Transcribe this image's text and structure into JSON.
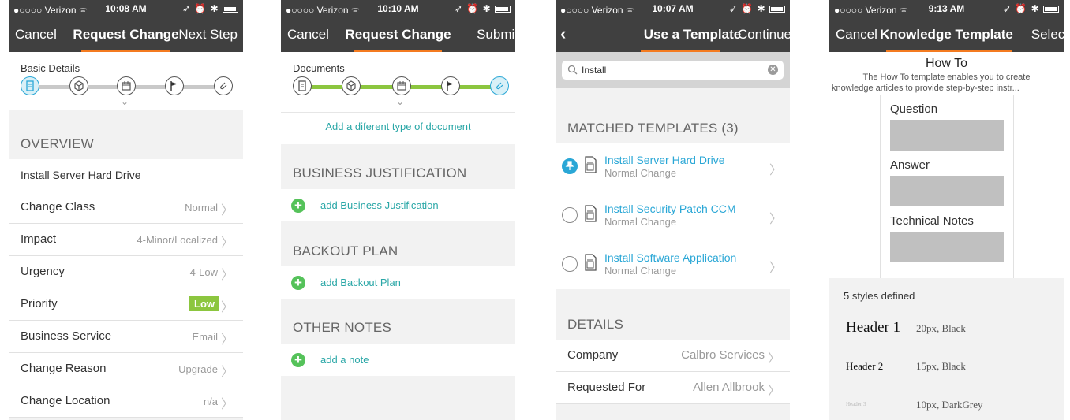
{
  "status": {
    "carrier": "●○○○○ Verizon ᯤ",
    "right_icons": "➶ ⏰ ✱"
  },
  "screen1": {
    "time": "10:08 AM",
    "nav_left": "Cancel",
    "nav_title": "Request Change",
    "nav_right": "Next Step",
    "step_label": "Basic Details",
    "section_overview": "OVERVIEW",
    "summary": "Install Server Hard Drive",
    "rows": [
      {
        "label": "Change Class",
        "value": "Normal"
      },
      {
        "label": "Impact",
        "value": "4-Minor/Localized"
      },
      {
        "label": "Urgency",
        "value": "4-Low"
      },
      {
        "label": "Priority",
        "value": "Low"
      },
      {
        "label": "Business Service",
        "value": "Email"
      },
      {
        "label": "Change Reason",
        "value": "Upgrade"
      },
      {
        "label": "Change Location",
        "value": "n/a"
      }
    ],
    "priority_badge_color": "#8cc63f"
  },
  "screen2": {
    "time": "10:10 AM",
    "nav_left": "Cancel",
    "nav_title": "Request Change",
    "nav_right": "Submit",
    "step_label": "Documents",
    "add_doc_type": "Add a diferent type of document",
    "section_business": "BUSINESS JUSTIFICATION",
    "add_business": "add Business Justification",
    "section_backout": "BACKOUT PLAN",
    "add_backout": "add Backout Plan",
    "section_notes": "OTHER NOTES",
    "add_note": "add a note",
    "progress_color": "#8cc63f"
  },
  "screen3": {
    "time": "10:07 AM",
    "nav_title": "Use a Template",
    "nav_right": "Continue",
    "search_value": "Install",
    "section_matched": "MATCHED TEMPLATES (3)",
    "templates": [
      {
        "title": "Install Server Hard Drive",
        "subtitle": "Normal Change",
        "selected": true
      },
      {
        "title": "Install Security Patch CCM",
        "subtitle": "Normal Change",
        "selected": false
      },
      {
        "title": "Install Software Application",
        "subtitle": "Normal Change",
        "selected": false
      }
    ],
    "section_details": "DETAILS",
    "details": [
      {
        "label": "Company",
        "value": "Calbro Services"
      },
      {
        "label": "Requested For",
        "value": "Allen Allbrook"
      }
    ]
  },
  "screen4": {
    "time": "9:13 AM",
    "nav_left": "Cancel",
    "nav_title": "Knowledge Template",
    "nav_right": "Select",
    "template_title": "How To",
    "template_desc_1": "The How To template enables you to create",
    "template_desc_2": "knowledge articles to provide step-by-step instr...",
    "fields": [
      "Question",
      "Answer",
      "Technical Notes"
    ],
    "styles_count": "5 styles defined",
    "styles": [
      {
        "name": "Header 1",
        "spec": "20px, Black"
      },
      {
        "name": "Header 2",
        "spec": "15px, Black"
      },
      {
        "name": "Header 3",
        "spec": "10px, DarkGrey"
      }
    ]
  },
  "colors": {
    "nav_bg": "#404040",
    "accent": "#f47b20",
    "teal": "#2aa7a7",
    "link_blue": "#2aa7d6",
    "add_green": "#55c25a"
  }
}
